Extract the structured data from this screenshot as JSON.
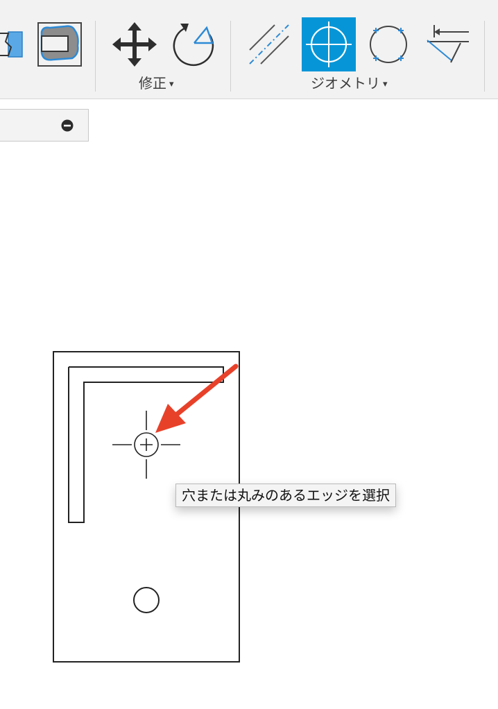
{
  "ribbon": {
    "groups": [
      {
        "label": "修正",
        "caret": "▾",
        "tools": [
          "move-copy-icon",
          "rotate-icon"
        ]
      },
      {
        "label": "ジオメトリ",
        "caret": "▾",
        "tools": [
          "offset-lines-icon",
          "center-mark-icon",
          "circle-quadrant-points-icon",
          "trim-extend-icon"
        ]
      }
    ],
    "active_tool": "center-mark-icon",
    "accent_color": "#0696d7"
  },
  "browser_panel": {
    "collapse_icon": "minus-circle-icon"
  },
  "canvas": {
    "tooltip": "穴または丸みのあるエッジを選択",
    "annotation_arrow_color": "#e8412a",
    "cursor": "crosshair-target-cursor"
  }
}
